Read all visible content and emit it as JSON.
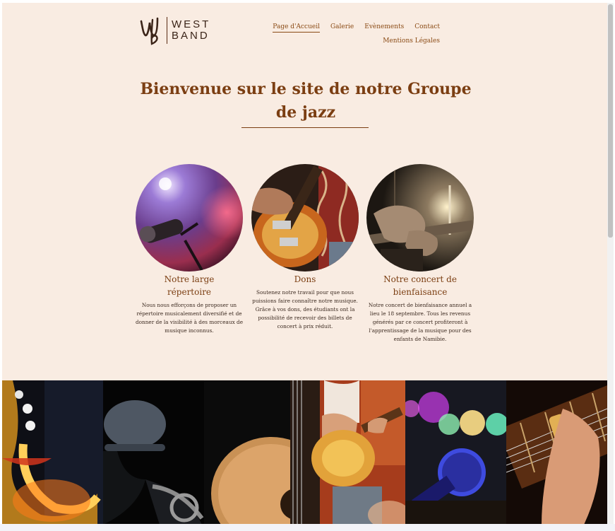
{
  "logo": {
    "line1": "WEST",
    "line2": "BAND"
  },
  "nav": {
    "items": [
      {
        "label": "Page d'Accueil"
      },
      {
        "label": "Galerie"
      },
      {
        "label": "Evènements"
      },
      {
        "label": "Contact"
      },
      {
        "label": "Mentions Légales"
      }
    ]
  },
  "hero": {
    "title": "Bienvenue sur le site de notre Groupe de jazz"
  },
  "features": [
    {
      "title": "Notre large répertoire",
      "text": "Nous nous efforçons de proposer un répertoire musicalement diversifié et de donner de la visibilité à des morceaux de musique inconnus.",
      "image": "microphone-on-stage"
    },
    {
      "title": "Dons",
      "text": "Soutenez notre travail pour que nous puissions faire connaître notre musique. Grâce à vos dons, des étudiants ont la possibilité de recevoir des billets de concert à prix réduit.",
      "image": "electric-guitar"
    },
    {
      "title": "Notre concert de bienfaisance",
      "text": "Notre concert de bienfaisance annuel a lieu le 18 septembre. Tous les revenus générés par ce concert profiteront à l'apprentissage de la musique pour des enfants de Namibie.",
      "image": "hands-playing-guitar"
    }
  ],
  "gallery": [
    {
      "image": "saxophone"
    },
    {
      "image": "saxophone-player-with-hat"
    },
    {
      "image": "acoustic-guitar"
    },
    {
      "image": "guitarist"
    },
    {
      "image": "microphone-bokeh"
    },
    {
      "image": "guitar-slide"
    }
  ],
  "colors": {
    "background": "#f9ece2",
    "accent": "#7b3e12",
    "nav": "#8a4a14"
  }
}
